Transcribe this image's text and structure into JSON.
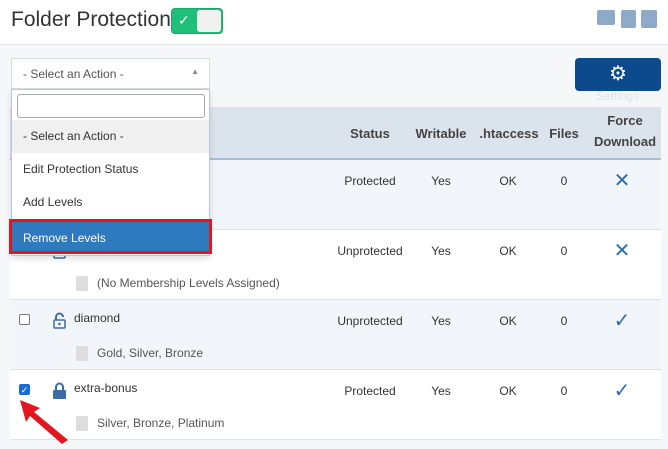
{
  "header": {
    "title": "Folder Protection",
    "toggle_on": true,
    "icons": [
      "video-icon",
      "search-doc-icon",
      "user-icon"
    ]
  },
  "action_select": {
    "value": "- Select an Action -",
    "search_placeholder": "",
    "options": [
      "- Select an Action -",
      "Edit Protection Status",
      "Add Levels",
      "Remove Levels"
    ],
    "highlighted": "Remove Levels"
  },
  "settings": {
    "label": "Settings"
  },
  "table": {
    "columns": [
      "Status",
      "Writable",
      ".htaccess",
      "Files",
      "Force",
      "Download"
    ],
    "rows": [
      {
        "name": "",
        "status": "Protected",
        "writable": "Yes",
        "htaccess": "OK",
        "files": "0",
        "force_download": false,
        "levels": "",
        "checked": false,
        "locked": true
      },
      {
        "name": "",
        "status": "Unprotected",
        "writable": "Yes",
        "htaccess": "OK",
        "files": "0",
        "force_download": false,
        "levels": "(No Membership Levels Assigned)",
        "checked": false,
        "locked": false
      },
      {
        "name": "diamond",
        "status": "Unprotected",
        "writable": "Yes",
        "htaccess": "OK",
        "files": "0",
        "force_download": true,
        "levels": "Gold, Silver, Bronze",
        "checked": false,
        "locked": false
      },
      {
        "name": "extra-bonus",
        "status": "Protected",
        "writable": "Yes",
        "htaccess": "OK",
        "files": "0",
        "force_download": true,
        "levels": "Silver, Bronze, Platinum",
        "checked": true,
        "locked": true
      }
    ]
  },
  "colors": {
    "accent": "#0d4a8b",
    "toggle": "#1fbf7a",
    "highlight": "#2f7abf",
    "annotation": "#e3161f"
  }
}
